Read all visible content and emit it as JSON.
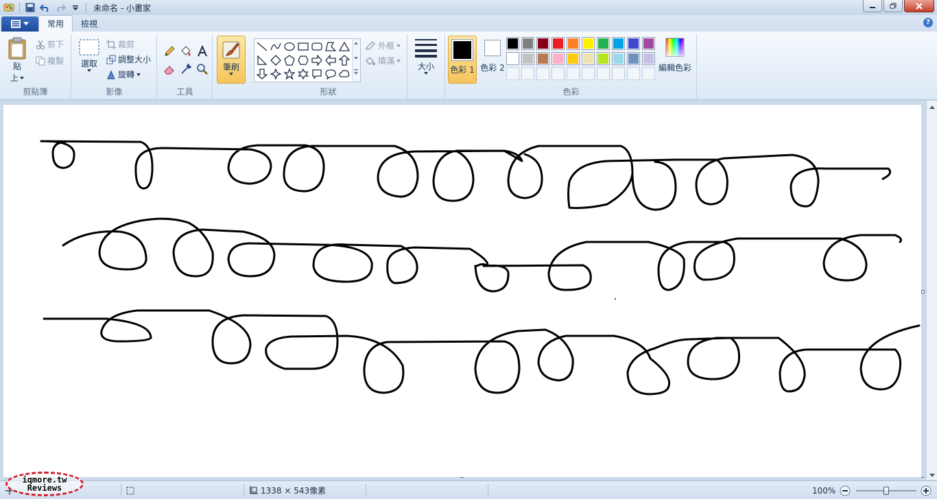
{
  "window": {
    "title": "未命名 - 小畫家"
  },
  "tabs": [
    {
      "label": "常用",
      "active": true
    },
    {
      "label": "檢視",
      "active": false
    }
  ],
  "ribbon": {
    "clipboard": {
      "group_label": "剪貼簿",
      "paste_label_1": "貼",
      "paste_label_2": "上",
      "cut_label": "剪下",
      "copy_label": "複製"
    },
    "image": {
      "group_label": "影像",
      "select_label": "選取",
      "crop_label": "裁剪",
      "resize_label": "調整大小",
      "rotate_label": "旋轉"
    },
    "tools": {
      "group_label": "工具"
    },
    "brushes": {
      "label": "筆刷"
    },
    "shapes": {
      "group_label": "形狀",
      "outline_label": "外框",
      "fill_label": "填滿"
    },
    "size": {
      "label": "大小"
    },
    "colors": {
      "group_label": "色彩",
      "color1_label": "色彩 1",
      "color2_label": "色彩 2",
      "edit_colors_label": "編輯色彩",
      "color1": "#000000",
      "color2": "#ffffff",
      "palette_row1": [
        "#000000",
        "#7f7f7f",
        "#880015",
        "#ed1c24",
        "#ff7f27",
        "#fff200",
        "#22b14c",
        "#00a2e8",
        "#3f48cc",
        "#a349a4"
      ],
      "palette_row2": [
        "#ffffff",
        "#c3c3c3",
        "#b97a57",
        "#ffaec9",
        "#ffc90e",
        "#efe4b0",
        "#b5e61d",
        "#99d9ea",
        "#7092be",
        "#c8bfe7"
      ]
    }
  },
  "statusbar": {
    "dimensions": "1338 × 543像素",
    "zoom": "100%"
  },
  "watermark": {
    "line1": "iqmore.tw",
    "line2": "Reviews"
  }
}
